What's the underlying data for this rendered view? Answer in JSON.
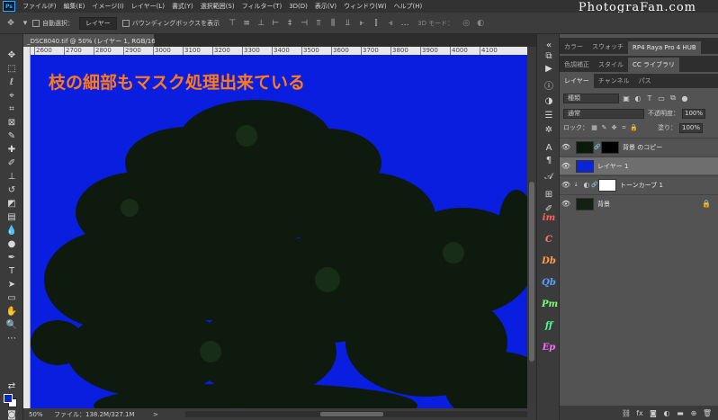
{
  "menubar": {
    "logo": "Ps",
    "items": [
      "ファイル(F)",
      "編集(E)",
      "イメージ(I)",
      "レイヤー(L)",
      "書式(Y)",
      "選択範囲(S)",
      "フィルター(T)",
      "3D(D)",
      "表示(V)",
      "ウィンドウ(W)",
      "ヘルプ(H)"
    ],
    "watermark": "PhotograFan.com"
  },
  "options": {
    "auto_select_label": "自動選択：",
    "auto_select_value": "レイヤー",
    "bounding_box_label": "バウンディングボックスを表示",
    "mode_3d_label": "3D モード："
  },
  "document": {
    "tab_title": "_DSC8040.tif @ 50% (レイヤー 1, RGB/16) *",
    "overlay_text": "枝の細部もマスク処理出来ている",
    "ruler_ticks": [
      "2600",
      "2700",
      "2800",
      "2900",
      "3000",
      "3100",
      "3200",
      "3300",
      "3400",
      "3500",
      "3600",
      "3700",
      "3800",
      "3900",
      "4000",
      "4100"
    ],
    "canvas_color": "#0a1ee0"
  },
  "status": {
    "zoom": "50%",
    "file_info": "ファイル：138.2M/327.1M",
    "arrow": ">"
  },
  "panels": {
    "top_tabs": [
      "カラー",
      "スウォッチ",
      "RP4 Raya Pro 4 HUB"
    ],
    "second_tabs": [
      "色調補正",
      "スタイル",
      "CC ライブラリ"
    ],
    "layer_tabs": [
      "レイヤー",
      "チャンネル",
      "パス"
    ],
    "kind_label": "種類",
    "blend_mode": "通常",
    "opacity_label": "不透明度：",
    "opacity_value": "100%",
    "lock_label": "ロック：",
    "fill_label": "塗り：",
    "fill_value": "100%",
    "layers": [
      {
        "name": "背景 のコピー",
        "thumb": "#0b1a0b",
        "selected": false
      },
      {
        "name": "レイヤー 1",
        "thumb": "#0a25d8",
        "selected": true
      },
      {
        "name": "トーンカーブ 1",
        "thumb": "#ffffff",
        "selected": false
      },
      {
        "name": "背景",
        "thumb": "#152015",
        "selected": false
      }
    ]
  },
  "colors": {
    "foreground": "#0a25c9",
    "background": "#ffffff",
    "overlay_text": "#ff7a1a"
  }
}
